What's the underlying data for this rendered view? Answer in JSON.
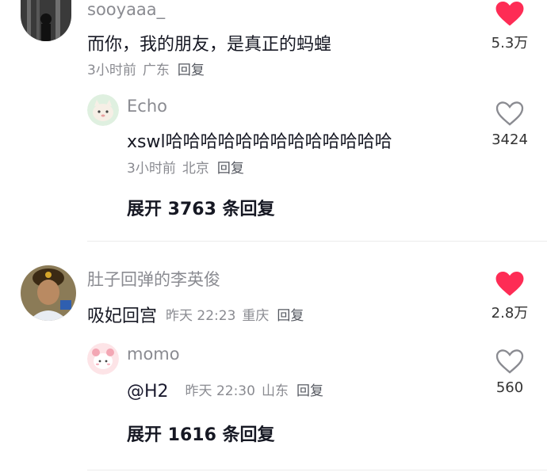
{
  "colors": {
    "liked_heart": "#fe2c55",
    "unliked_heart": "#8a8b91",
    "divider": "#ececec"
  },
  "comments": [
    {
      "username": "sooyaaa_",
      "text": "而你，我的朋友，是真正的蚂蝗",
      "time": "3小时前",
      "location": "广东",
      "reply_label": "回复",
      "likes": "5.3万",
      "liked": true,
      "avatar_icon": "silhouette-avatar",
      "reply": {
        "username": "Echo",
        "text": "xswl哈哈哈哈哈哈哈哈哈哈哈哈哈",
        "time": "3小时前",
        "location": "北京",
        "reply_label": "回复",
        "likes": "3424",
        "liked": false,
        "avatar_icon": "cartoon-cat-avatar"
      },
      "expand_label": "展开 3763 条回复"
    },
    {
      "username": "肚子回弹的李英俊",
      "text": "吸妃回宫",
      "time": "昨天 22:23",
      "location": "重庆",
      "reply_label": "回复",
      "likes": "2.8万",
      "liked": true,
      "avatar_icon": "person-avatar",
      "reply": {
        "username": "momo",
        "text": "@H2",
        "time": "昨天 22:30",
        "location": "山东",
        "reply_label": "回复",
        "likes": "560",
        "liked": false,
        "avatar_icon": "pink-cartoon-avatar"
      },
      "expand_label": "展开 1616 条回复"
    }
  ]
}
